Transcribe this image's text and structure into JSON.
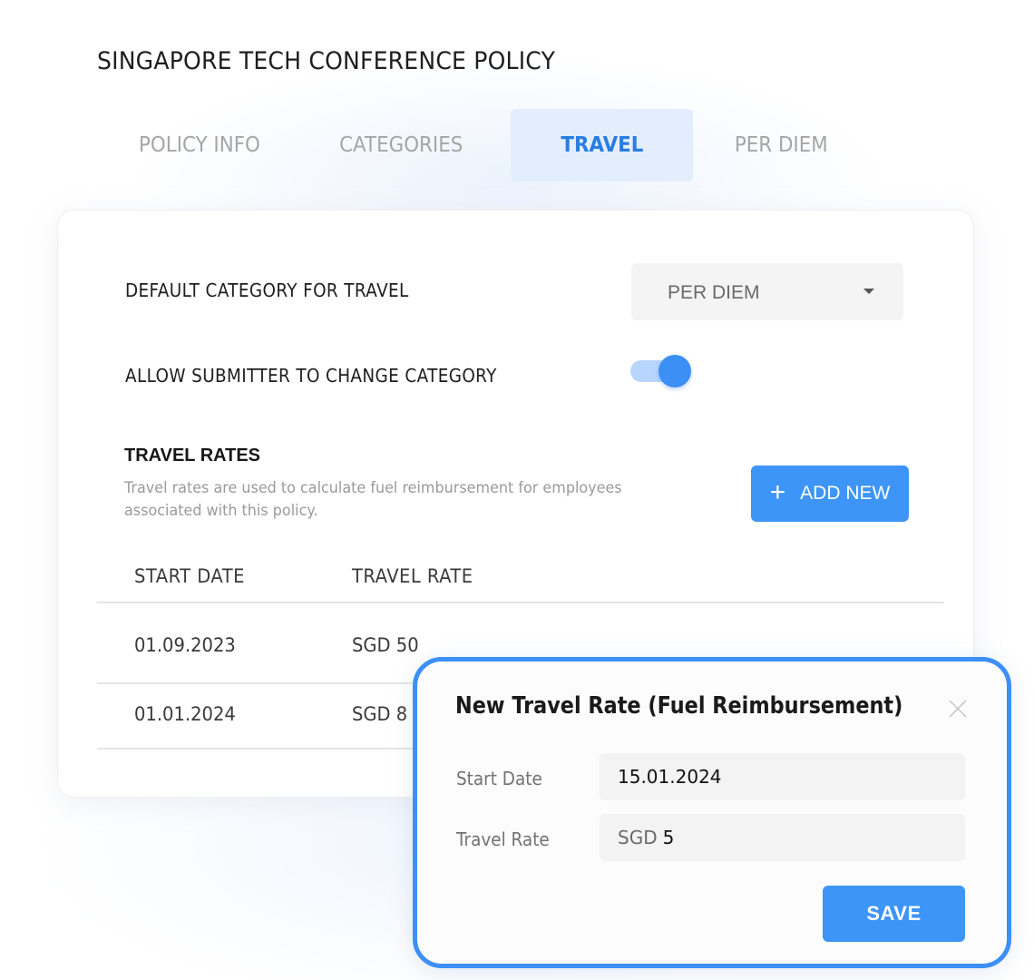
{
  "page": {
    "title": "SINGAPORE TECH CONFERENCE POLICY"
  },
  "tabs": [
    {
      "label": "POLICY INFO",
      "active": false
    },
    {
      "label": "CATEGORIES",
      "active": false
    },
    {
      "label": "TRAVEL",
      "active": true
    },
    {
      "label": "PER DIEM",
      "active": false
    }
  ],
  "settings": {
    "default_category_label": "DEFAULT CATEGORY FOR TRAVEL",
    "default_category_value": "PER DIEM",
    "allow_change_label": "ALLOW SUBMITTER TO CHANGE CATEGORY",
    "allow_change_enabled": true
  },
  "travel_rates": {
    "title": "TRAVEL RATES",
    "description": "Travel rates are used to calculate fuel reimbursement for employees associated with this policy.",
    "add_button_label": "ADD NEW",
    "add_button_icon": "plus-icon",
    "columns": [
      "START DATE",
      "TRAVEL RATE"
    ],
    "rows": [
      {
        "start_date": "01.09.2023",
        "rate": "SGD 50"
      },
      {
        "start_date": "01.01.2024",
        "rate": "SGD 8"
      }
    ]
  },
  "modal": {
    "title": "New Travel Rate (Fuel Reimbursement)",
    "close_icon": "close-icon",
    "start_date_label": "Start Date",
    "start_date_value": "15.01.2024",
    "travel_rate_label": "Travel Rate",
    "travel_rate_prefix": "SGD",
    "travel_rate_value": "5",
    "save_label": "SAVE"
  },
  "colors": {
    "accent": "#3d95f7",
    "tab_active_bg": "#e3eefd",
    "tab_active_text": "#2a7de1",
    "toggle_track": "#b7d5fd"
  }
}
